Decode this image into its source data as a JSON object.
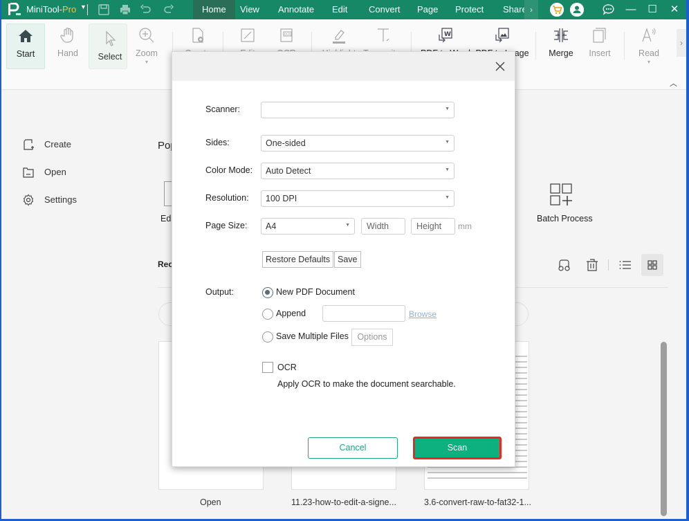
{
  "app": {
    "name_main": "MiniTool-",
    "name_suffix": "Pro",
    "brand_color": "#168865",
    "accent_color": "#0db07f",
    "menus": [
      {
        "label": "Home",
        "active": true
      },
      {
        "label": "View"
      },
      {
        "label": "Annotate"
      },
      {
        "label": "Edit"
      },
      {
        "label": "Convert"
      },
      {
        "label": "Page"
      },
      {
        "label": "Protect"
      },
      {
        "label": "Share"
      }
    ],
    "menu_more": "›",
    "window_controls": {
      "minimize": "—",
      "maximize": "☐",
      "close": "✕"
    }
  },
  "ribbon": {
    "tools": [
      {
        "label": "Start",
        "icon": "home-icon"
      },
      {
        "label": "Hand",
        "icon": "hand-icon"
      },
      {
        "label": "Select",
        "icon": "cursor-icon"
      },
      {
        "label": "Zoom",
        "icon": "zoom-icon",
        "caret": "▾"
      },
      {
        "label": "Create",
        "icon": "create-icon"
      },
      {
        "label": "Edit",
        "icon": "edit-icon"
      },
      {
        "label": "OCR",
        "icon": "ocr-icon"
      },
      {
        "label": "Highlight",
        "icon": "highlight-icon"
      },
      {
        "label": "Typewriter",
        "icon": "typewriter-icon"
      },
      {
        "label": "PDF to Word",
        "icon": "pdf-to-word-icon"
      },
      {
        "label": "PDF to Image",
        "icon": "pdf-to-image-icon"
      },
      {
        "label": "Merge",
        "icon": "merge-icon"
      },
      {
        "label": "Insert",
        "icon": "insert-icon"
      },
      {
        "label": "Read",
        "icon": "read-icon",
        "caret": "▾"
      }
    ],
    "next": "›",
    "collapse": "︿"
  },
  "sidebar": {
    "items": [
      {
        "label": "Create",
        "icon": "create-file-icon"
      },
      {
        "label": "Open",
        "icon": "folder-icon"
      },
      {
        "label": "Settings",
        "icon": "gear-icon"
      }
    ]
  },
  "home": {
    "popular_title": "Pop",
    "edit_tool_label": "Edi",
    "batch_label": "Batch Process",
    "recent_title": "Rec",
    "files": [
      {
        "name": "Open"
      },
      {
        "name": "11.23-how-to-edit-a-signe..."
      },
      {
        "name": "3.6-convert-raw-to-fat32-1..."
      }
    ]
  },
  "dialog": {
    "fields": {
      "scanner": {
        "label": "Scanner:",
        "value": ""
      },
      "sides": {
        "label": "Sides:",
        "value": "One-sided"
      },
      "color_mode": {
        "label": "Color Mode:",
        "value": "Auto Detect"
      },
      "resolution": {
        "label": "Resolution:",
        "value": "100 DPI"
      },
      "page_size": {
        "label": "Page Size:",
        "value": "A4",
        "width_placeholder": "Width",
        "height_placeholder": "Height",
        "unit": "mm"
      }
    },
    "restore_defaults": "Restore Defaults",
    "save": "Save",
    "output": {
      "label": "Output:",
      "options": [
        {
          "label": "New PDF Document",
          "checked": true
        },
        {
          "label": "Append",
          "checked": false
        },
        {
          "label": "Save Multiple Files",
          "checked": false
        }
      ],
      "append_path": "",
      "browse": "Browse",
      "options_button": "Options"
    },
    "ocr": {
      "label": "OCR",
      "checked": false,
      "hint": "Apply OCR to make the document searchable."
    },
    "cancel": "Cancel",
    "scan": "Scan"
  }
}
